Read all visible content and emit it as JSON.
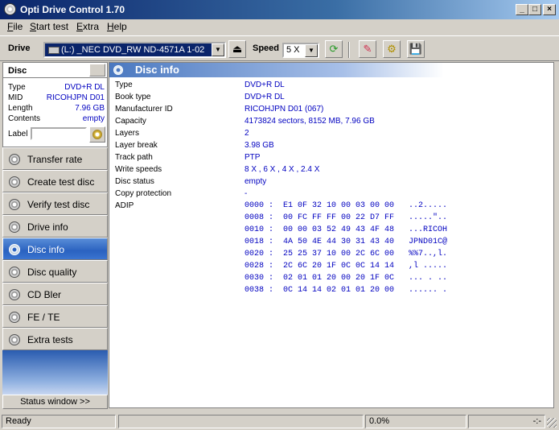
{
  "window": {
    "title": "Opti Drive Control 1.70"
  },
  "menu": [
    {
      "label": "File",
      "u": "F",
      "rest": "ile"
    },
    {
      "label": "Start test",
      "u": "S",
      "rest": "tart test"
    },
    {
      "label": "Extra",
      "u": "E",
      "rest": "xtra"
    },
    {
      "label": "Help",
      "u": "H",
      "rest": "elp"
    }
  ],
  "toolbar": {
    "drive_label": "Drive",
    "drive_value": "(L:)   _NEC DVD_RW ND-4571A 1-02",
    "speed_label": "Speed",
    "speed_value": "5 X"
  },
  "disc_panel": {
    "header": "Disc",
    "props": [
      {
        "key": "Type",
        "value": "DVD+R DL"
      },
      {
        "key": "MID",
        "value": "RICOHJPN D01"
      },
      {
        "key": "Length",
        "value": "7.96 GB"
      },
      {
        "key": "Contents",
        "value": "empty"
      }
    ],
    "label_key": "Label"
  },
  "nav": [
    {
      "label": "Transfer rate",
      "active": false
    },
    {
      "label": "Create test disc",
      "active": false
    },
    {
      "label": "Verify test disc",
      "active": false
    },
    {
      "label": "Drive info",
      "active": false
    },
    {
      "label": "Disc info",
      "active": true
    },
    {
      "label": "Disc quality",
      "active": false
    },
    {
      "label": "CD Bler",
      "active": false
    },
    {
      "label": "FE / TE",
      "active": false
    },
    {
      "label": "Extra tests",
      "active": false
    }
  ],
  "status_window_button": "Status window >>",
  "main": {
    "header": "Disc info",
    "rows": [
      {
        "key": "Type",
        "value": "DVD+R DL"
      },
      {
        "key": "Book type",
        "value": "DVD+R DL"
      },
      {
        "key": "Manufacturer ID",
        "value": "RICOHJPN D01 (067)"
      },
      {
        "key": "Capacity",
        "value": "4173824 sectors, 8152 MB, 7.96 GB"
      },
      {
        "key": "Layers",
        "value": "2"
      },
      {
        "key": "Layer break",
        "value": "3.98 GB"
      },
      {
        "key": "Track path",
        "value": "PTP"
      },
      {
        "key": "Write speeds",
        "value": "8 X , 6 X , 4 X , 2.4 X"
      },
      {
        "key": "Disc status",
        "value": "empty"
      },
      {
        "key": "Copy protection",
        "value": "-"
      }
    ],
    "adip_key": "ADIP",
    "adip_lines": [
      "0000 :  E1 0F 32 10 00 03 00 00   ..2.....",
      "0008 :  00 FC FF FF 00 22 D7 FF   .....\"..",
      "0010 :  00 00 03 52 49 43 4F 48   ...RICOH",
      "0018 :  4A 50 4E 44 30 31 43 40   JPND01C@",
      "0020 :  25 25 37 10 00 2C 6C 00   %%7..,l.",
      "0028 :  2C 6C 20 1F 0C 0C 14 14   ,l .....",
      "0030 :  02 01 01 20 00 20 1F 0C   ... . ..",
      "0038 :  0C 14 14 02 01 01 20 00   ...... ."
    ]
  },
  "statusbar": {
    "status": "Ready",
    "progress": "0.0%",
    "time": "-:-"
  }
}
